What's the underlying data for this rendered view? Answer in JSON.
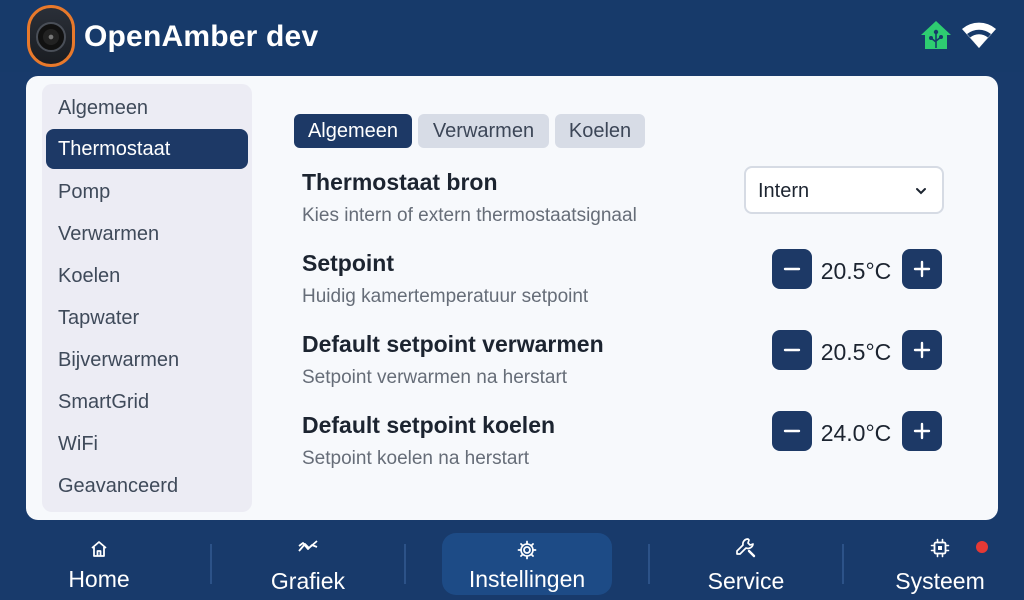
{
  "header": {
    "title": "OpenAmber dev",
    "logo_icon": "heat-pump-logo-icon",
    "status_icons": [
      "home-assistant-icon",
      "wifi-icon"
    ]
  },
  "sidebar": {
    "items": [
      {
        "label": "Algemeen",
        "active": false
      },
      {
        "label": "Thermostaat",
        "active": true
      },
      {
        "label": "Pomp",
        "active": false
      },
      {
        "label": "Verwarmen",
        "active": false
      },
      {
        "label": "Koelen",
        "active": false
      },
      {
        "label": "Tapwater",
        "active": false
      },
      {
        "label": "Bijverwarmen",
        "active": false
      },
      {
        "label": "SmartGrid",
        "active": false
      },
      {
        "label": "WiFi",
        "active": false
      },
      {
        "label": "Geavanceerd",
        "active": false
      }
    ]
  },
  "tabs": [
    {
      "label": "Algemeen",
      "active": true
    },
    {
      "label": "Verwarmen",
      "active": false
    },
    {
      "label": "Koelen",
      "active": false
    }
  ],
  "settings": {
    "source": {
      "title": "Thermostaat bron",
      "description": "Kies intern of extern thermostaatsignaal",
      "value": "Intern"
    },
    "setpoint": {
      "title": "Setpoint",
      "description": "Huidig kamertemperatuur setpoint",
      "value": "20.5°C"
    },
    "heating_default": {
      "title": "Default setpoint verwarmen",
      "description": "Setpoint verwarmen na herstart",
      "value": "20.5°C"
    },
    "cooling_default": {
      "title": "Default setpoint koelen",
      "description": "Setpoint koelen na herstart",
      "value": "24.0°C"
    }
  },
  "bottom_nav": {
    "items": [
      {
        "label": "Home",
        "icon": "home-icon",
        "active": false
      },
      {
        "label": "Grafiek",
        "icon": "chart-icon",
        "active": false
      },
      {
        "label": "Instellingen",
        "icon": "gear-icon",
        "active": true
      },
      {
        "label": "Service",
        "icon": "wrench-icon",
        "active": false
      },
      {
        "label": "Systeem",
        "icon": "chip-icon",
        "active": false
      }
    ]
  },
  "colors": {
    "primary": "#1d3966",
    "header_bg": "#173a6a",
    "accent_orange": "#e8792b",
    "status_green": "#2ecc71",
    "alert_red": "#e53935"
  }
}
